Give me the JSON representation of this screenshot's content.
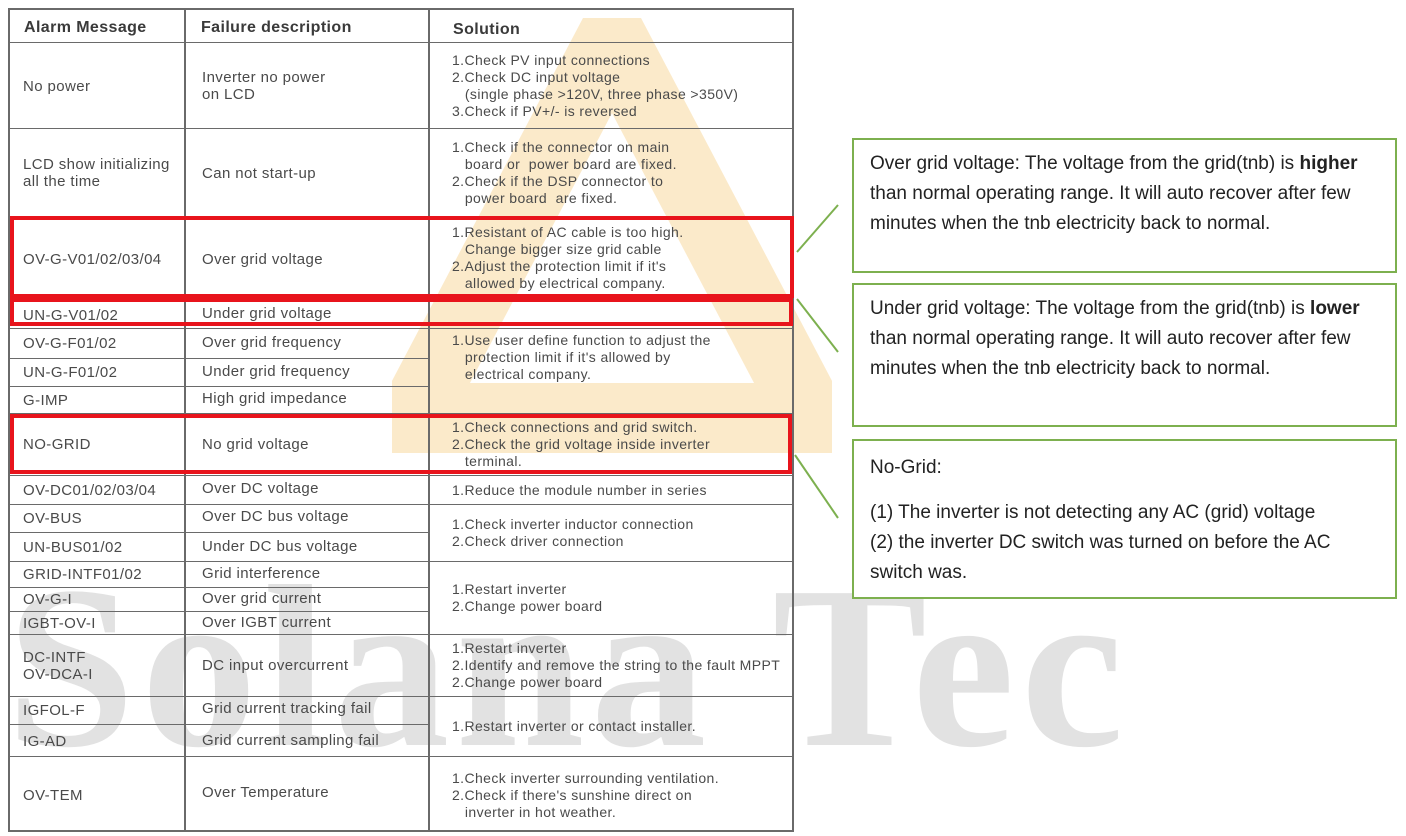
{
  "table": {
    "headers": [
      "Alarm Message",
      "Failure description",
      "Solution"
    ],
    "rows": [
      {
        "alarm": "No power",
        "desc": "Inverter no power\non LCD"
      },
      {
        "alarm": "LCD show initializing\nall the time",
        "desc": "Can not start-up"
      },
      {
        "alarm": "OV-G-V01/02/03/04",
        "desc": "Over grid voltage"
      },
      {
        "alarm": "UN-G-V01/02",
        "desc": "Under grid voltage"
      },
      {
        "alarm": "OV-G-F01/02",
        "desc": "Over grid frequency"
      },
      {
        "alarm": "UN-G-F01/02",
        "desc": "Under grid frequency"
      },
      {
        "alarm": "G-IMP",
        "desc": "High grid impedance"
      },
      {
        "alarm": "NO-GRID",
        "desc": "No grid voltage"
      },
      {
        "alarm": "OV-DC01/02/03/04",
        "desc": "Over DC voltage"
      },
      {
        "alarm": "OV-BUS",
        "desc": "Over DC bus voltage"
      },
      {
        "alarm": "UN-BUS01/02",
        "desc": "Under DC bus voltage"
      },
      {
        "alarm": "GRID-INTF01/02",
        "desc": "Grid interference"
      },
      {
        "alarm": "OV-G-I",
        "desc": "Over grid current"
      },
      {
        "alarm": "IGBT-OV-I",
        "desc": "Over IGBT current"
      },
      {
        "alarm": "DC-INTF\nOV-DCA-I",
        "desc": "DC input overcurrent"
      },
      {
        "alarm": "IGFOL-F",
        "desc": "Grid current tracking fail"
      },
      {
        "alarm": "IG-AD",
        "desc": "Grid current sampling fail"
      },
      {
        "alarm": "OV-TEM",
        "desc": "Over Temperature"
      }
    ],
    "solutions": [
      "1.Check PV input connections\n2.Check DC input voltage\n   (single phase >120V, three phase >350V)\n3.Check if PV+/- is reversed",
      "1.Check if the connector on main\n   board or  power board are fixed.\n2.Check if the DSP connector to\n   power board  are fixed.",
      "1.Resistant of AC cable is too high.\n   Change bigger size grid cable\n2.Adjust the protection limit if it's\n   allowed by electrical company.",
      "1.Use user define function to adjust the\n   protection limit if it's allowed by\n   electrical company.",
      "1.Check connections and grid switch.\n2.Check the grid voltage inside inverter\n   terminal.",
      "1.Reduce the module number in series",
      "1.Check inverter inductor connection\n2.Check driver connection",
      "1.Restart inverter\n2.Change power board",
      "1.Restart inverter\n2.Identify and remove the string to the fault MPPT\n2.Change power board",
      "1.Restart inverter or contact installer.",
      "1.Check inverter surrounding ventilation.\n2.Check if there's sunshine direct on\n   inverter in hot weather."
    ]
  },
  "notes": {
    "over": {
      "a": "Over grid voltage: The voltage from the grid(tnb) is ",
      "bold": "higher",
      "b": " than normal operating range. It will auto recover after few minutes when the tnb electricity back to normal."
    },
    "under": {
      "a": "Under grid voltage: The voltage from the grid(tnb) is ",
      "bold": "lower",
      "b": " than normal operating range. It will auto recover after few minutes when the tnb electricity back to normal."
    },
    "nogrid": {
      "title": "No-Grid:",
      "line1": "(1) The inverter is not detecting any AC (grid) voltage",
      "line2": "(2) the inverter DC switch was turned on before the AC switch was."
    }
  },
  "watermark": "Solana Tec",
  "colors": {
    "highlight": "#e8141c",
    "note_border": "#7db04f",
    "watermark": "#dedede"
  }
}
